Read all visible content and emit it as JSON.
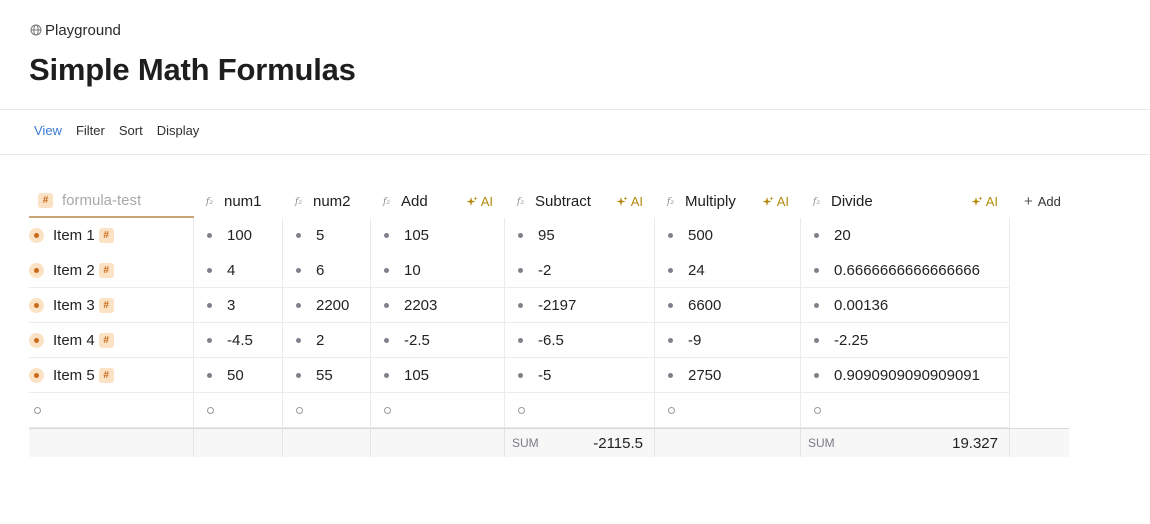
{
  "breadcrumb": {
    "label": "Playground",
    "icon": "globe-icon"
  },
  "page": {
    "title": "Simple Math Formulas"
  },
  "toolbar": {
    "view": "View",
    "filter": "Filter",
    "sort": "Sort",
    "display": "Display"
  },
  "colors": {
    "accent": "#3b7bd4",
    "ai": "#b58a0c",
    "tag_bg": "#fbe2c4",
    "tag_fg": "#c86b1b"
  },
  "table": {
    "name_header": "formula-test",
    "columns": {
      "num1": "num1",
      "num2": "num2",
      "add": "Add",
      "subtract": "Subtract",
      "multiply": "Multiply",
      "divide": "Divide"
    },
    "ai_label": "AI",
    "add_column": "Add",
    "rows": [
      {
        "name": "Item 1",
        "num1": "100",
        "num2": "5",
        "add": "105",
        "subtract": "95",
        "multiply": "500",
        "divide": "20"
      },
      {
        "name": "Item 2",
        "num1": "4",
        "num2": "6",
        "add": "10",
        "subtract": "-2",
        "multiply": "24",
        "divide": "0.6666666666666666"
      },
      {
        "name": "Item 3",
        "num1": "3",
        "num2": "2200",
        "add": "2203",
        "subtract": "-2197",
        "multiply": "6600",
        "divide": "0.00136"
      },
      {
        "name": "Item 4",
        "num1": "-4.5",
        "num2": "2",
        "add": "-2.5",
        "subtract": "-6.5",
        "multiply": "-9",
        "divide": "-2.25"
      },
      {
        "name": "Item 5",
        "num1": "50",
        "num2": "55",
        "add": "105",
        "subtract": "-5",
        "multiply": "2750",
        "divide": "0.9090909090909091"
      }
    ],
    "summary": {
      "subtract_label": "SUM",
      "subtract_value": "-2115.5",
      "divide_label": "SUM",
      "divide_value": "19.327"
    }
  }
}
